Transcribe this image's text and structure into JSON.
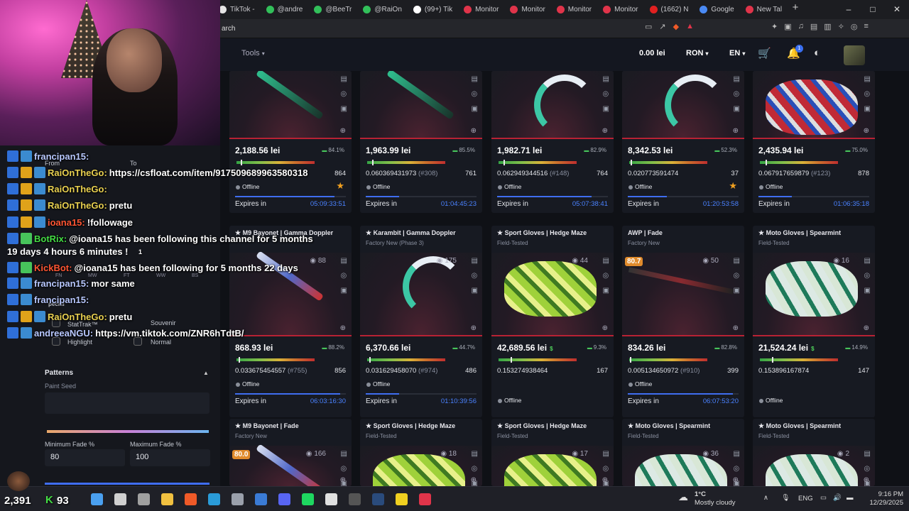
{
  "browser": {
    "tabs": [
      {
        "label": "TikTok -",
        "color": "#e5e5e5"
      },
      {
        "label": "@andre",
        "color": "#32c05a"
      },
      {
        "label": "@BeeTr",
        "color": "#32c05a"
      },
      {
        "label": "@RaiOn",
        "color": "#32c05a"
      },
      {
        "label": "(99+) Tik",
        "color": "#ffffff"
      },
      {
        "label": "Monitor",
        "color": "#e0344a"
      },
      {
        "label": "Monitor",
        "color": "#e0344a"
      },
      {
        "label": "Monitor",
        "color": "#e0344a"
      },
      {
        "label": "Monitor",
        "color": "#e0344a"
      },
      {
        "label": "(1662) N",
        "color": "#e02020"
      },
      {
        "label": "Google",
        "color": "#4a8af4"
      },
      {
        "label": "New Tal",
        "color": "#e0344a"
      }
    ],
    "new_tab": "+",
    "address_text": "arch",
    "window_controls": [
      "–",
      "□",
      "✕"
    ]
  },
  "header": {
    "tools_label": "Tools",
    "balance": "0.00 lei",
    "currency": "RON",
    "language": "EN",
    "notifications_count": "1"
  },
  "cards": [
    {
      "title": "",
      "subtitle": "",
      "views": "",
      "fade": "",
      "price": "2,188.56 lei",
      "discount": "84.1%",
      "float_value": "",
      "paint": "",
      "float_num": "864",
      "status": "Offline",
      "starred": true,
      "expires_label": "Expires in",
      "timer": "05:09:33:51",
      "exp_fill": 0.9,
      "float_marker": 0.05,
      "shape": "knife"
    },
    {
      "title": "",
      "subtitle": "",
      "views": "",
      "fade": "",
      "price": "1,963.99 lei",
      "discount": "85.5%",
      "float_value": "0.060369431973",
      "paint": "(#308)",
      "float_num": "761",
      "status": "Offline",
      "starred": false,
      "expires_label": "Expires in",
      "timer": "01:04:45:23",
      "exp_fill": 0.3,
      "float_marker": 0.06,
      "shape": "knife"
    },
    {
      "title": "",
      "subtitle": "",
      "views": "",
      "fade": "",
      "price": "1,982.71 lei",
      "discount": "82.9%",
      "float_value": "0.062949344516",
      "paint": "(#148)",
      "float_num": "764",
      "status": "Offline",
      "starred": false,
      "expires_label": "Expires in",
      "timer": "05:07:38:41",
      "exp_fill": 0.85,
      "float_marker": 0.06,
      "shape": "karam"
    },
    {
      "title": "",
      "subtitle": "",
      "views": "",
      "fade": "",
      "price": "8,342.53 lei",
      "discount": "52.3%",
      "float_value": "0.020773591474",
      "paint": "",
      "float_num": "37",
      "status": "Offline",
      "starred": true,
      "expires_label": "Expires in",
      "timer": "01:20:53:58",
      "exp_fill": 0.35,
      "float_marker": 0.02,
      "shape": "karam"
    },
    {
      "title": "",
      "subtitle": "",
      "views": "",
      "fade": "",
      "price": "2,435.94 lei",
      "discount": "75.0%",
      "float_value": "0.067917659879",
      "paint": "(#123)",
      "float_num": "878",
      "status": "Offline",
      "starred": false,
      "expires_label": "Expires in",
      "timer": "01:06:35:18",
      "exp_fill": 0.3,
      "float_marker": 0.07,
      "shape": "glove-red"
    },
    {
      "title": "★ M9 Bayonet | Gamma Doppler",
      "subtitle": "",
      "views": "88",
      "fade": "",
      "price": "868.93 lei",
      "discount": "88.2%",
      "float_value": "0.033675454557",
      "paint": "(#755)",
      "float_num": "856",
      "status": "Offline",
      "starred": false,
      "expires_label": "Expires in",
      "timer": "06:03:16:30",
      "exp_fill": 0.95,
      "float_marker": 0.03,
      "shape": "knife-blue"
    },
    {
      "title": "★ Karambit | Gamma Doppler",
      "subtitle": "Factory New (Phase 3)",
      "views": "175",
      "fade": "",
      "price": "6,370.66 lei",
      "discount": "44.7%",
      "float_value": "0.031629458070",
      "paint": "(#974)",
      "float_num": "486",
      "status": "Offline",
      "starred": false,
      "expires_label": "Expires in",
      "timer": "01:10:39:56",
      "exp_fill": 0.3,
      "float_marker": 0.03,
      "shape": "karam"
    },
    {
      "title": "★ Sport Gloves | Hedge Maze",
      "subtitle": "Field-Tested",
      "views": "44",
      "fade": "",
      "price": "42,689.56 lei",
      "discount": "9.3%",
      "float_value": "0.153274938464",
      "paint": "",
      "float_num": "167",
      "status": "Offline",
      "starred": false,
      "expires_label": "",
      "timer": "",
      "exp_fill": 0,
      "float_marker": 0.15,
      "shape": "glove-hedge",
      "dollar": "$"
    },
    {
      "title": "AWP | Fade",
      "subtitle": "Factory New",
      "views": "50",
      "fade": "80.7",
      "price": "834.26 lei",
      "discount": "82.8%",
      "float_value": "0.005134650972",
      "paint": "(#910)",
      "float_num": "399",
      "status": "Offline",
      "starred": false,
      "expires_label": "Expires in",
      "timer": "06:07:53:20",
      "exp_fill": 0.95,
      "float_marker": 0.01,
      "shape": "awp"
    },
    {
      "title": "★ Moto Gloves | Spearmint",
      "subtitle": "Field-Tested",
      "views": "16",
      "fade": "",
      "price": "21,524.24 lei",
      "discount": "14.9%",
      "float_value": "0.153896167874",
      "paint": "",
      "float_num": "147",
      "status": "Offline",
      "starred": false,
      "expires_label": "",
      "timer": "",
      "exp_fill": 0,
      "float_marker": 0.15,
      "shape": "glove",
      "dollar": "$"
    },
    {
      "title": "★ M9 Bayonet | Fade",
      "subtitle": "Factory New",
      "views": "166",
      "fade": "80.0",
      "price": "",
      "discount": "",
      "float_value": "",
      "paint": "",
      "float_num": "",
      "status": "",
      "starred": false,
      "expires_label": "",
      "timer": "",
      "exp_fill": 0,
      "float_marker": 0,
      "shape": "knife-fade"
    },
    {
      "title": "★ Sport Gloves | Hedge Maze",
      "subtitle": "Field-Tested",
      "views": "18",
      "fade": "",
      "price": "",
      "discount": "",
      "float_value": "",
      "paint": "",
      "float_num": "",
      "status": "",
      "starred": false,
      "expires_label": "",
      "timer": "",
      "exp_fill": 0,
      "float_marker": 0,
      "shape": "glove-hedge"
    },
    {
      "title": "★ Sport Gloves | Hedge Maze",
      "subtitle": "Field-Tested",
      "views": "17",
      "fade": "",
      "price": "",
      "discount": "",
      "float_value": "",
      "paint": "",
      "float_num": "",
      "status": "",
      "starred": false,
      "expires_label": "",
      "timer": "",
      "exp_fill": 0,
      "float_marker": 0,
      "shape": "glove-hedge"
    },
    {
      "title": "★ Moto Gloves | Spearmint",
      "subtitle": "Field-Tested",
      "views": "36",
      "fade": "",
      "price": "",
      "discount": "",
      "float_value": "",
      "paint": "",
      "float_num": "",
      "status": "",
      "starred": false,
      "expires_label": "",
      "timer": "",
      "exp_fill": 0,
      "float_marker": 0,
      "shape": "glove"
    },
    {
      "title": "★ Moto Gloves | Spearmint",
      "subtitle": "Field-Tested",
      "views": "2",
      "fade": "",
      "price": "",
      "discount": "",
      "float_value": "",
      "paint": "",
      "float_num": "",
      "status": "",
      "starred": false,
      "expires_label": "",
      "timer": "",
      "exp_fill": 0,
      "float_marker": 0,
      "shape": "glove"
    }
  ],
  "filters": {
    "from": "From",
    "to": "To",
    "wear_labels": [
      "FN",
      "MW",
      "FT",
      "WW",
      "BS"
    ],
    "category_labels": [
      "StatTrak™",
      "Souvenir",
      "Highlight",
      "Normal"
    ],
    "special_label": "pecial",
    "patterns_title": "Patterns",
    "paint_seed_label": "Paint Seed",
    "min_fade_label": "Minimum Fade %",
    "max_fade_label": "Maximum Fade %",
    "min_fade": "80",
    "max_fade": "100"
  },
  "chat": [
    {
      "user": "francipan15:",
      "text": "",
      "badges": [
        "b1",
        "b2"
      ],
      "ucls": "ucyan"
    },
    {
      "user": "RaiOnTheGo:",
      "text": "https://csfloat.com/item/917509689963580318",
      "badges": [
        "b1",
        "b3",
        "b2"
      ],
      "ucls": ""
    },
    {
      "user": "RaiOnTheGo:",
      "text": "",
      "badges": [
        "b1",
        "b3",
        "b2"
      ],
      "ucls": ""
    },
    {
      "user": "RaiOnTheGo:",
      "text": "pretu",
      "badges": [
        "b1",
        "b3",
        "b2"
      ],
      "ucls": ""
    },
    {
      "user": "ioana15:",
      "text": "!followage",
      "badges": [
        "b1",
        "b3",
        "b2"
      ],
      "ucls": "ured"
    },
    {
      "user": "BotRix:",
      "text": "@ioana15 has been following this channel for 5 months",
      "badges": [
        "b1",
        "b4"
      ],
      "ucls": "ugreen"
    },
    {
      "user": "KickBot:",
      "text": "@ioana15 has been following for 5 months 22 days",
      "badges": [
        "b1",
        "b4"
      ],
      "ucls": "ured"
    },
    {
      "user": "francipan15:",
      "text": "mor same",
      "badges": [
        "b1",
        "b2"
      ],
      "ucls": "ucyan"
    },
    {
      "user": "francipan15:",
      "text": "",
      "badges": [
        "b1",
        "b2"
      ],
      "ucls": "ucyan"
    },
    {
      "user": "RaiOnTheGo:",
      "text": "pretu",
      "badges": [
        "b1",
        "b3",
        "b2"
      ],
      "ucls": ""
    },
    {
      "user": "andreeaNGU:",
      "text": "https://vm.tiktok.com/ZNR6hTdtB/",
      "badges": [
        "b1",
        "b2"
      ],
      "ucls": "ucyan"
    }
  ],
  "chat_continuation": "19 days 4 hours 6 minutes !",
  "chat_digit": "1",
  "stream": {
    "viewers": "2,391",
    "kicks": "93"
  },
  "taskbar": {
    "temperature": "1°C",
    "weather": "Mostly cloudy",
    "language": "ENG",
    "time": "9:16 PM",
    "date": "12/29/2025",
    "icons": [
      "start-icon",
      "search-icon",
      "task-view-icon",
      "files-icon",
      "brave-icon",
      "edge-icon",
      "settings-icon",
      "store-icon",
      "discord-icon",
      "spotify-icon",
      "tiktok-icon",
      "obs-icon",
      "steam-icon",
      "app-icon",
      "app2-icon"
    ]
  }
}
